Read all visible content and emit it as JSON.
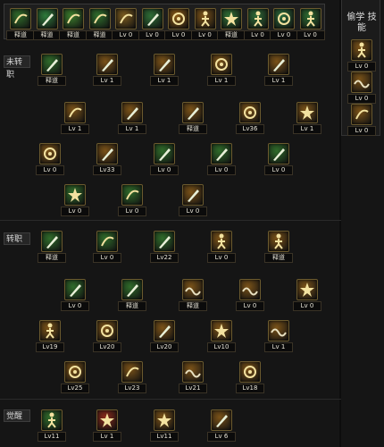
{
  "topbar": {
    "skills": [
      {
        "lv": "释道",
        "icon": "bird-icon",
        "color": "#2f6b2a"
      },
      {
        "lv": "释道",
        "icon": "sword-slash-icon",
        "color": "#2e7a3a"
      },
      {
        "lv": "释道",
        "icon": "claw-icon",
        "color": "#3b7d2c"
      },
      {
        "lv": "释道",
        "icon": "grass-icon",
        "color": "#2f6e2c"
      },
      {
        "lv": "Lv 0",
        "icon": "wings-icon",
        "color": "#7a5a1e"
      },
      {
        "lv": "Lv 0",
        "icon": "blade-figure-icon",
        "color": "#2e6e36"
      },
      {
        "lv": "Lv 0",
        "icon": "vortex-icon",
        "color": "#8a5a16"
      },
      {
        "lv": "Lv 0",
        "icon": "warrior-icon",
        "color": "#7a5218"
      },
      {
        "lv": "释道",
        "icon": "star-burst-icon",
        "color": "#2f6e34"
      },
      {
        "lv": "Lv 0",
        "icon": "fighter-icon",
        "color": "#2e6a36"
      },
      {
        "lv": "Lv 0",
        "icon": "spiral-icon",
        "color": "#2c6a3a"
      },
      {
        "lv": "Lv 0",
        "icon": "runner-icon",
        "color": "#2c6a30"
      }
    ]
  },
  "side_panel": {
    "title": "偷学 技能",
    "skills": [
      {
        "lv": "Lv 0",
        "icon": "arrow-kick-icon",
        "color": "#7a5218"
      },
      {
        "lv": "Lv 0",
        "icon": "wave-arc-icon",
        "color": "#7a5218"
      },
      {
        "lv": "Lv 0",
        "icon": "crescent-icon",
        "color": "#7a5218"
      }
    ]
  },
  "sections": {
    "untransferred": "未转职",
    "transferred": "转职",
    "awakening": "觉醒"
  },
  "tree1": [
    {
      "lv": "释道",
      "icon": "sword-rain-icon",
      "color": "#2f6b2a"
    },
    {
      "lv": "Lv 1",
      "icon": "slash-wave-icon",
      "color": "#7a5218"
    },
    {
      "lv": "Lv 1",
      "icon": "wind-slash-icon",
      "color": "#7a5218"
    },
    {
      "lv": "Lv 1",
      "icon": "swirl-icon",
      "color": "#7a5218"
    },
    {
      "lv": "Lv 1",
      "icon": "thrust-icon",
      "color": "#7a5218"
    },
    {
      "lv": "Lv 1",
      "icon": "shield-icon",
      "color": "#7a5218"
    },
    {
      "lv": "Lv 1",
      "icon": "triple-blade-icon",
      "color": "#7a5218"
    },
    {
      "lv": "释道",
      "icon": "flame-blades-icon",
      "color": "#7a5218"
    },
    {
      "lv": "Lv36",
      "icon": "cyclone-icon",
      "color": "#7a5218"
    },
    {
      "lv": "Lv 1",
      "icon": "impact-icon",
      "color": "#7a5218"
    },
    {
      "lv": "Lv 0",
      "icon": "ring-icon",
      "color": "#7a5218"
    },
    {
      "lv": "Lv33",
      "icon": "moon-slash-icon",
      "color": "#7a5218"
    },
    {
      "lv": "Lv 0",
      "icon": "spear-icon",
      "color": "#2f6b2a"
    },
    {
      "lv": "Lv 0",
      "icon": "green-blade-icon",
      "color": "#2f6b2a"
    },
    {
      "lv": "Lv 0",
      "icon": "great-sword-icon",
      "color": "#2f6b2a"
    },
    {
      "lv": "Lv 0",
      "icon": "starburst-icon",
      "color": "#2f6b2a"
    },
    {
      "lv": "Lv 0",
      "icon": "dash-icon",
      "color": "#2f6b2a"
    },
    {
      "lv": "Lv 0",
      "icon": "cross-sword-icon",
      "color": "#7a5218"
    }
  ],
  "tree2": [
    {
      "lv": "释道",
      "icon": "blade-leap-icon",
      "color": "#2f6b2a"
    },
    {
      "lv": "Lv 0",
      "icon": "crescent-leaf-icon",
      "color": "#2f6b2a"
    },
    {
      "lv": "Lv22",
      "icon": "diagonal-slash-icon",
      "color": "#2f6b2a"
    },
    {
      "lv": "Lv 0",
      "icon": "dancer-icon",
      "color": "#7a5218"
    },
    {
      "lv": "释道",
      "icon": "kick-icon",
      "color": "#7a5218"
    },
    {
      "lv": "Lv 0",
      "icon": "twin-blade-icon",
      "color": "#2f6b2a"
    },
    {
      "lv": "释道",
      "icon": "feather-blade-icon",
      "color": "#2f6b2a"
    },
    {
      "lv": "释道",
      "icon": "flow-icon",
      "color": "#7a5218"
    },
    {
      "lv": "Lv 0",
      "icon": "gust-icon",
      "color": "#7a5218"
    },
    {
      "lv": "Lv 0",
      "icon": "cross-star-icon",
      "color": "#7a5218"
    },
    {
      "lv": "Lv19",
      "icon": "flame-figure-icon",
      "color": "#7a5218"
    },
    {
      "lv": "Lv20",
      "icon": "tornado-icon",
      "color": "#7a5218"
    },
    {
      "lv": "Lv20",
      "icon": "stab-icon",
      "color": "#7a5218"
    },
    {
      "lv": "Lv10",
      "icon": "flow-burst-icon",
      "color": "#7a5218"
    },
    {
      "lv": "Lv 1",
      "icon": "lines-icon",
      "color": "#7a5218"
    },
    {
      "lv": "Lv25",
      "icon": "spin-icon",
      "color": "#7a5218"
    },
    {
      "lv": "Lv23",
      "icon": "hook-icon",
      "color": "#7a5218"
    },
    {
      "lv": "Lv21",
      "icon": "swift-icon",
      "color": "#7a5218"
    },
    {
      "lv": "Lv18",
      "icon": "portal-icon",
      "color": "#7a5218"
    }
  ],
  "tree3": [
    {
      "lv": "Lv11",
      "icon": "green-warrior-icon",
      "color": "#2f6b2a"
    },
    {
      "lv": "Lv 1",
      "icon": "red-eruption-icon",
      "color": "#8a2a1a"
    },
    {
      "lv": "Lv11",
      "icon": "blast-icon",
      "color": "#7a5218"
    },
    {
      "lv": "Lv 6",
      "icon": "arc-slash-icon",
      "color": "#7a5218"
    }
  ]
}
